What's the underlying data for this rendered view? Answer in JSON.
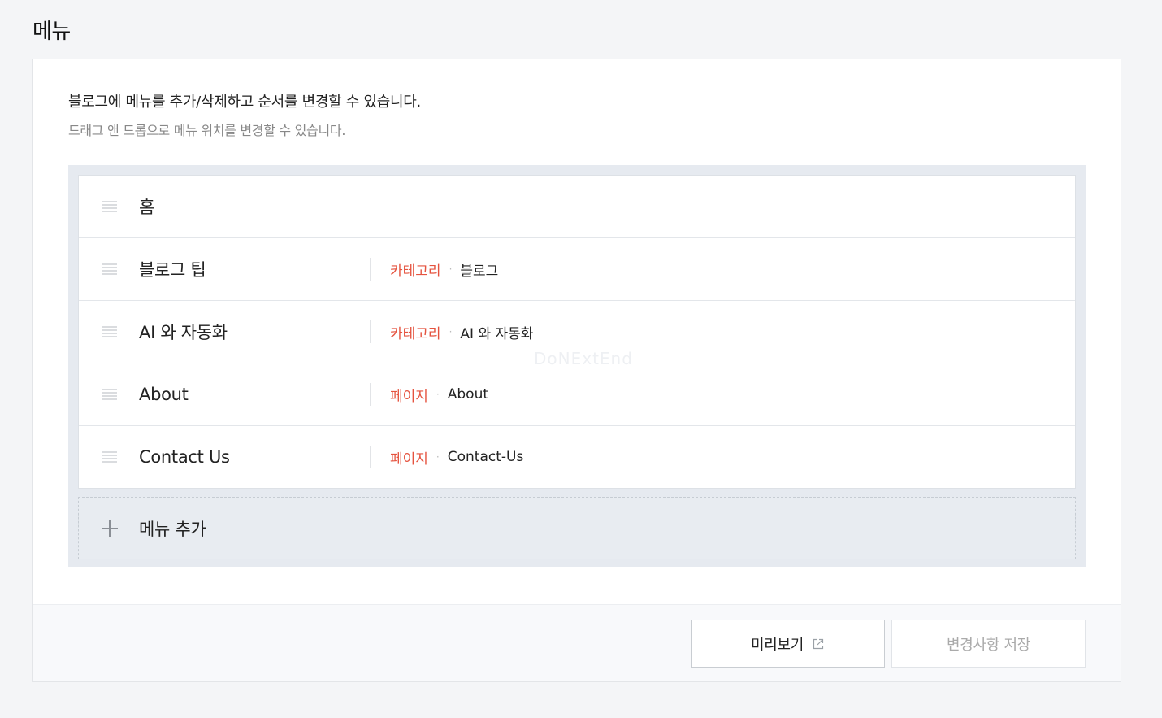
{
  "page": {
    "title": "메뉴"
  },
  "description": {
    "main": "블로그에 메뉴를 추가/삭제하고 순서를 변경할 수 있습니다.",
    "sub": "드래그 앤 드롭으로 메뉴 위치를 변경할 수 있습니다."
  },
  "menu": {
    "items": [
      {
        "name": "홈",
        "type": "",
        "target": ""
      },
      {
        "name": "블로그 팁",
        "type": "카테고리",
        "target": "블로그"
      },
      {
        "name": "AI 와 자동화",
        "type": "카테고리",
        "target": "AI 와 자동화"
      },
      {
        "name": "About",
        "type": "페이지",
        "target": "About"
      },
      {
        "name": "Contact Us",
        "type": "페이지",
        "target": "Contact-Us"
      }
    ],
    "separator": "·",
    "add_label": "메뉴 추가"
  },
  "watermark": "DoNExtEnd",
  "footer": {
    "preview_label": "미리보기",
    "save_label": "변경사항 저장"
  },
  "colors": {
    "accent": "#e5533f",
    "background": "#f4f5f7",
    "menu_box": "#e6eaf0"
  },
  "icons": {
    "drag": "drag-handle-icon",
    "add": "plus-icon",
    "external": "external-link-icon"
  }
}
